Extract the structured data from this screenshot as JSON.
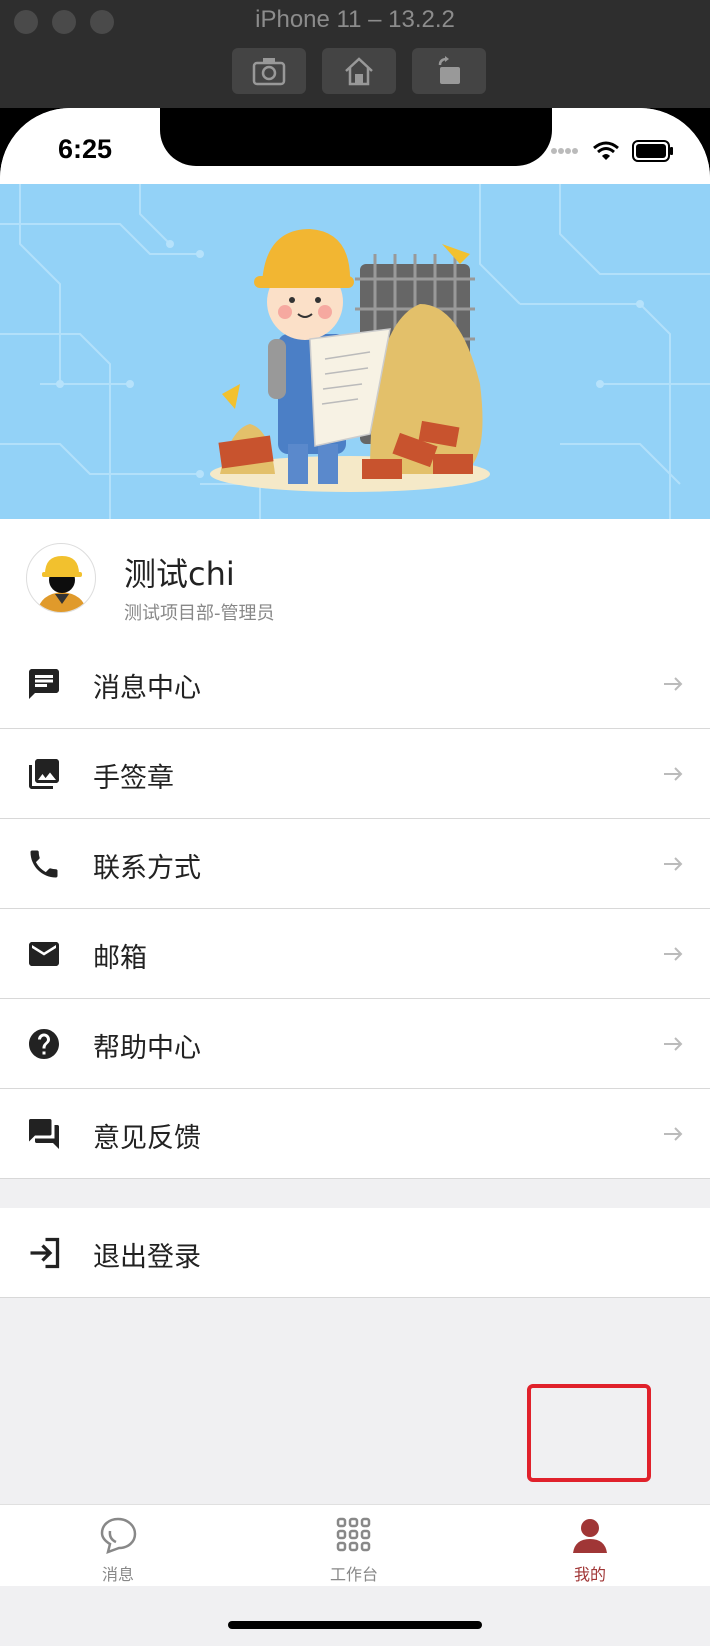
{
  "simulator": {
    "title": "iPhone 11 – 13.2.2",
    "buttons": [
      "screenshot-icon",
      "home-icon",
      "rotate-icon"
    ]
  },
  "status_bar": {
    "time": "6:25"
  },
  "profile": {
    "name": "测试chi",
    "role": "测试项目部-管理员"
  },
  "menu": {
    "items": [
      {
        "label": "消息中心",
        "icon": "message-icon"
      },
      {
        "label": "手签章",
        "icon": "photo-library-icon"
      },
      {
        "label": "联系方式",
        "icon": "phone-icon"
      },
      {
        "label": "邮箱",
        "icon": "mail-icon"
      },
      {
        "label": "帮助中心",
        "icon": "help-icon"
      },
      {
        "label": "意见反馈",
        "icon": "feedback-icon"
      }
    ],
    "logout_label": "退出登录"
  },
  "tabbar": {
    "tabs": [
      {
        "label": "消息",
        "icon": "chat-bubble-icon"
      },
      {
        "label": "工作台",
        "icon": "grid-icon"
      },
      {
        "label": "我的",
        "icon": "person-icon"
      }
    ],
    "active_index": 2
  },
  "colors": {
    "accent": "#a03636",
    "banner_bg": "#93d2f7",
    "highlight": "#e0212b"
  }
}
